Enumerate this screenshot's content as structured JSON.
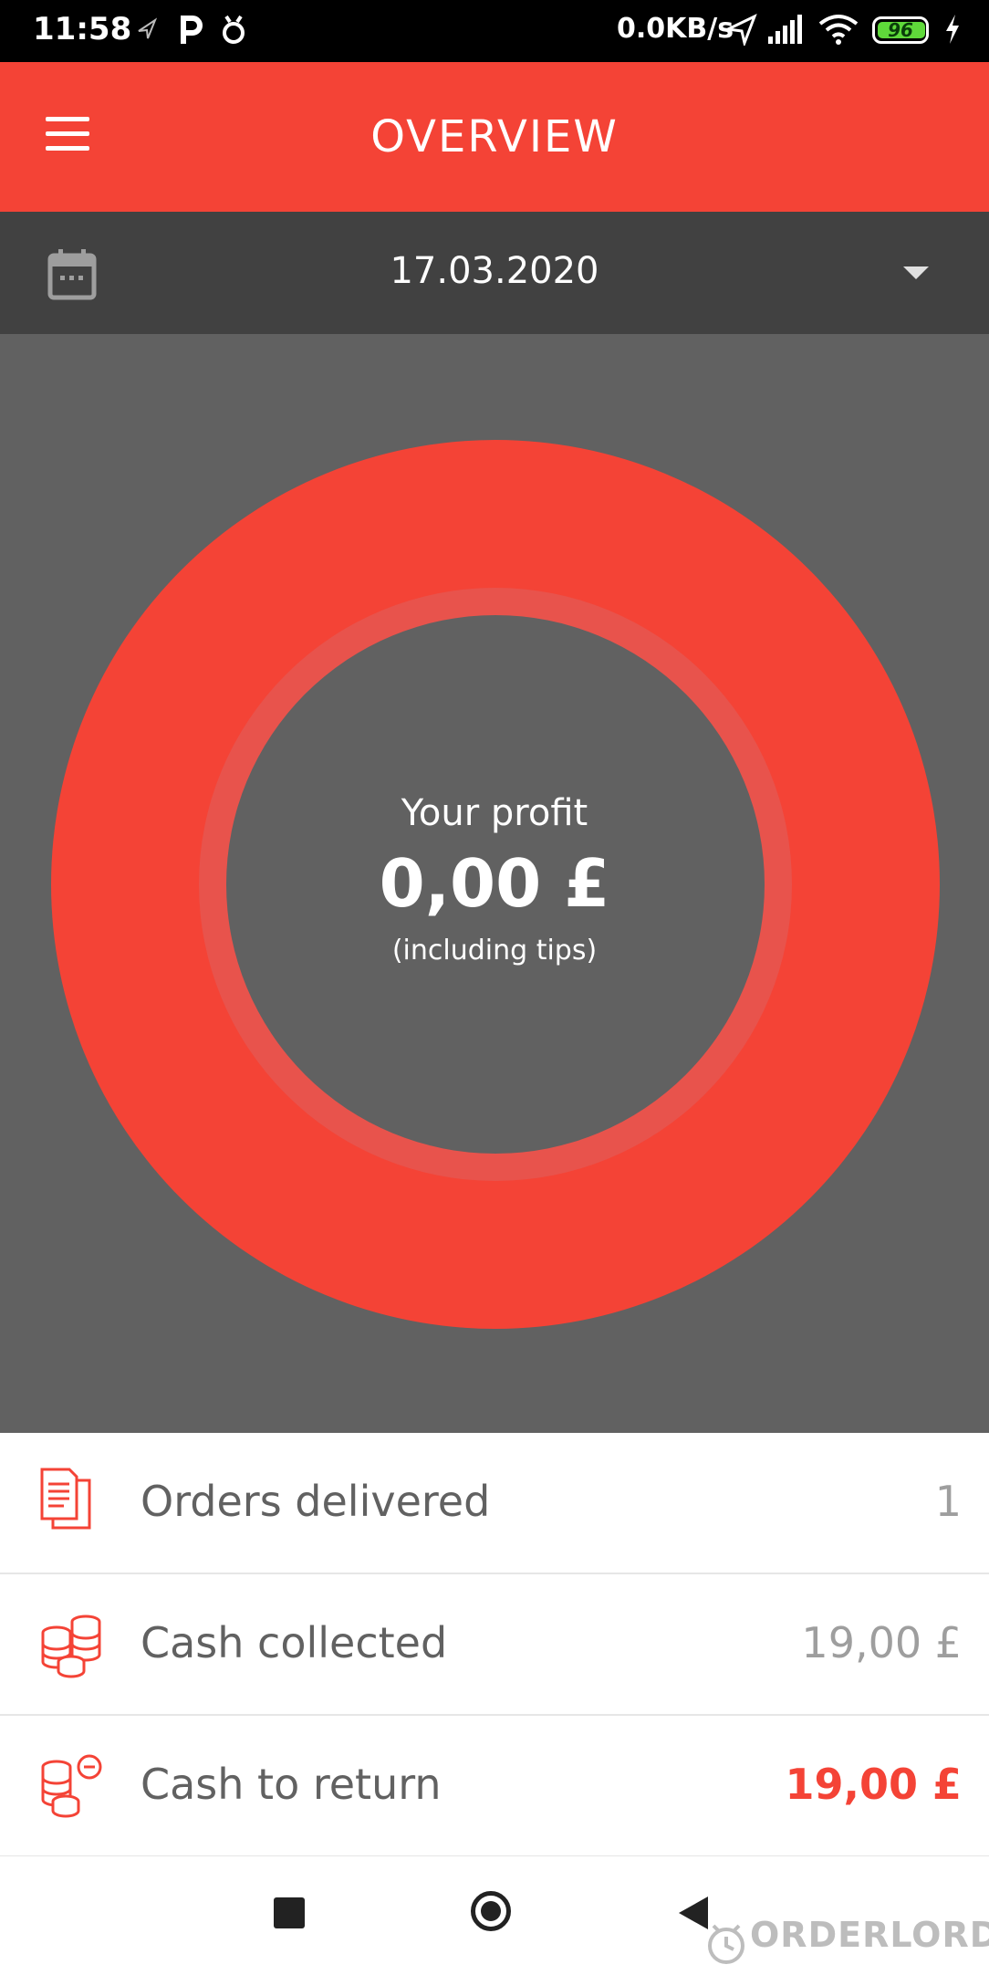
{
  "status_bar": {
    "time": "11:58",
    "network_speed": "0.0KB/s",
    "battery_level": "96"
  },
  "app_bar": {
    "title": "OVERVIEW"
  },
  "date_selector": {
    "date": "17.03.2020"
  },
  "profit": {
    "label": "Your profit",
    "value": "0,00 £",
    "note": "(including tips)"
  },
  "stats": [
    {
      "label": "Orders delivered",
      "value": "1",
      "icon": "documents-icon"
    },
    {
      "label": "Cash collected",
      "value": "19,00 £",
      "icon": "coins-icon"
    },
    {
      "label": "Cash to return",
      "value": "19,00 £",
      "icon": "coins-minus-icon"
    }
  ],
  "watermark": "ORDERLORD",
  "colors": {
    "accent": "#f44336",
    "dark": "#414141",
    "chart_bg": "#616161"
  }
}
